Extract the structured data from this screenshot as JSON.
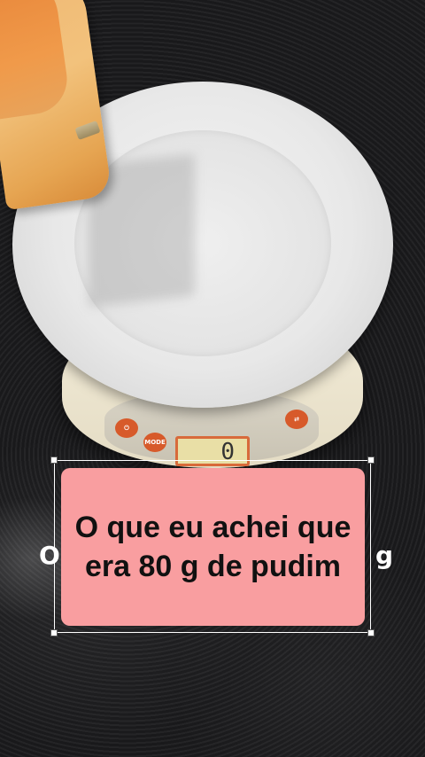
{
  "caption": {
    "text": "O que eu achei que era 80 g de pudim",
    "background_color": "#f99ea0",
    "text_color": "#111111"
  },
  "background_caption": {
    "left_fragment": "O",
    "right_fragment": "g"
  },
  "scale": {
    "display_value": "0",
    "buttons": [
      "power",
      "MODE",
      "unit"
    ],
    "mode_label": "MODE"
  },
  "selection_frame": {
    "handles": [
      "top-left",
      "top-right",
      "bottom-left",
      "bottom-right"
    ]
  }
}
